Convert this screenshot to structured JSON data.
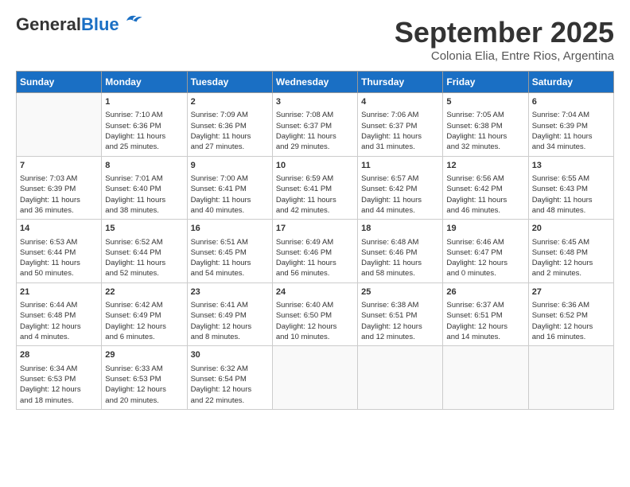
{
  "logo": {
    "general": "General",
    "blue": "Blue"
  },
  "title": "September 2025",
  "subtitle": "Colonia Elia, Entre Rios, Argentina",
  "days": [
    "Sunday",
    "Monday",
    "Tuesday",
    "Wednesday",
    "Thursday",
    "Friday",
    "Saturday"
  ],
  "weeks": [
    [
      {
        "day": "",
        "content": ""
      },
      {
        "day": "1",
        "content": "Sunrise: 7:10 AM\nSunset: 6:36 PM\nDaylight: 11 hours\nand 25 minutes."
      },
      {
        "day": "2",
        "content": "Sunrise: 7:09 AM\nSunset: 6:36 PM\nDaylight: 11 hours\nand 27 minutes."
      },
      {
        "day": "3",
        "content": "Sunrise: 7:08 AM\nSunset: 6:37 PM\nDaylight: 11 hours\nand 29 minutes."
      },
      {
        "day": "4",
        "content": "Sunrise: 7:06 AM\nSunset: 6:37 PM\nDaylight: 11 hours\nand 31 minutes."
      },
      {
        "day": "5",
        "content": "Sunrise: 7:05 AM\nSunset: 6:38 PM\nDaylight: 11 hours\nand 32 minutes."
      },
      {
        "day": "6",
        "content": "Sunrise: 7:04 AM\nSunset: 6:39 PM\nDaylight: 11 hours\nand 34 minutes."
      }
    ],
    [
      {
        "day": "7",
        "content": "Sunrise: 7:03 AM\nSunset: 6:39 PM\nDaylight: 11 hours\nand 36 minutes."
      },
      {
        "day": "8",
        "content": "Sunrise: 7:01 AM\nSunset: 6:40 PM\nDaylight: 11 hours\nand 38 minutes."
      },
      {
        "day": "9",
        "content": "Sunrise: 7:00 AM\nSunset: 6:41 PM\nDaylight: 11 hours\nand 40 minutes."
      },
      {
        "day": "10",
        "content": "Sunrise: 6:59 AM\nSunset: 6:41 PM\nDaylight: 11 hours\nand 42 minutes."
      },
      {
        "day": "11",
        "content": "Sunrise: 6:57 AM\nSunset: 6:42 PM\nDaylight: 11 hours\nand 44 minutes."
      },
      {
        "day": "12",
        "content": "Sunrise: 6:56 AM\nSunset: 6:42 PM\nDaylight: 11 hours\nand 46 minutes."
      },
      {
        "day": "13",
        "content": "Sunrise: 6:55 AM\nSunset: 6:43 PM\nDaylight: 11 hours\nand 48 minutes."
      }
    ],
    [
      {
        "day": "14",
        "content": "Sunrise: 6:53 AM\nSunset: 6:44 PM\nDaylight: 11 hours\nand 50 minutes."
      },
      {
        "day": "15",
        "content": "Sunrise: 6:52 AM\nSunset: 6:44 PM\nDaylight: 11 hours\nand 52 minutes."
      },
      {
        "day": "16",
        "content": "Sunrise: 6:51 AM\nSunset: 6:45 PM\nDaylight: 11 hours\nand 54 minutes."
      },
      {
        "day": "17",
        "content": "Sunrise: 6:49 AM\nSunset: 6:46 PM\nDaylight: 11 hours\nand 56 minutes."
      },
      {
        "day": "18",
        "content": "Sunrise: 6:48 AM\nSunset: 6:46 PM\nDaylight: 11 hours\nand 58 minutes."
      },
      {
        "day": "19",
        "content": "Sunrise: 6:46 AM\nSunset: 6:47 PM\nDaylight: 12 hours\nand 0 minutes."
      },
      {
        "day": "20",
        "content": "Sunrise: 6:45 AM\nSunset: 6:48 PM\nDaylight: 12 hours\nand 2 minutes."
      }
    ],
    [
      {
        "day": "21",
        "content": "Sunrise: 6:44 AM\nSunset: 6:48 PM\nDaylight: 12 hours\nand 4 minutes."
      },
      {
        "day": "22",
        "content": "Sunrise: 6:42 AM\nSunset: 6:49 PM\nDaylight: 12 hours\nand 6 minutes."
      },
      {
        "day": "23",
        "content": "Sunrise: 6:41 AM\nSunset: 6:49 PM\nDaylight: 12 hours\nand 8 minutes."
      },
      {
        "day": "24",
        "content": "Sunrise: 6:40 AM\nSunset: 6:50 PM\nDaylight: 12 hours\nand 10 minutes."
      },
      {
        "day": "25",
        "content": "Sunrise: 6:38 AM\nSunset: 6:51 PM\nDaylight: 12 hours\nand 12 minutes."
      },
      {
        "day": "26",
        "content": "Sunrise: 6:37 AM\nSunset: 6:51 PM\nDaylight: 12 hours\nand 14 minutes."
      },
      {
        "day": "27",
        "content": "Sunrise: 6:36 AM\nSunset: 6:52 PM\nDaylight: 12 hours\nand 16 minutes."
      }
    ],
    [
      {
        "day": "28",
        "content": "Sunrise: 6:34 AM\nSunset: 6:53 PM\nDaylight: 12 hours\nand 18 minutes."
      },
      {
        "day": "29",
        "content": "Sunrise: 6:33 AM\nSunset: 6:53 PM\nDaylight: 12 hours\nand 20 minutes."
      },
      {
        "day": "30",
        "content": "Sunrise: 6:32 AM\nSunset: 6:54 PM\nDaylight: 12 hours\nand 22 minutes."
      },
      {
        "day": "",
        "content": ""
      },
      {
        "day": "",
        "content": ""
      },
      {
        "day": "",
        "content": ""
      },
      {
        "day": "",
        "content": ""
      }
    ]
  ]
}
